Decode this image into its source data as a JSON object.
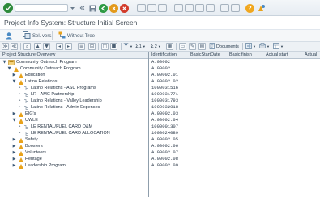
{
  "window": {
    "title": "Project Info System: Structure Initial Screen"
  },
  "app_toolbar": {
    "sel_vers_label": "Sel. vers.",
    "without_tree_label": "Without Tree"
  },
  "tree_toolbar": {
    "count_1": "1",
    "count_2": "2",
    "documents_label": "Documents"
  },
  "columns": {
    "overview": "Project Structure Overview",
    "identification": "Identification",
    "basic_start": "BasicStartDate",
    "basic_finish": "Basic finish",
    "actual_start": "Actual start",
    "actual_finish": "Actual"
  },
  "tree": [
    {
      "label": "Community Outreach Program",
      "id": "A.00002"
    },
    {
      "label": "Community Outreach Program",
      "id": "A.00002"
    },
    {
      "label": "Education",
      "id": "A.00002.01"
    },
    {
      "label": "Latino Relations",
      "id": "A.00002.02"
    },
    {
      "label": "Latino Relations - ASU Programs",
      "id": "1000031516"
    },
    {
      "label": "LR - AMC Partnership",
      "id": "1000031771"
    },
    {
      "label": "Latino Relations - Valley Leadership",
      "id": "1000031793"
    },
    {
      "label": "Latino Relations - Admin Expenses",
      "id": "1000032018"
    },
    {
      "label": "EIG's",
      "id": "A.00002.03"
    },
    {
      "label": "UWLE",
      "id": "A.00002.04"
    },
    {
      "label": "LE RENTAL/FUEL CARD O&M",
      "id": "1000001307"
    },
    {
      "label": "LE RENTAL/FUEL CARD ALLOCATION",
      "id": "1000024089"
    },
    {
      "label": "Safety",
      "id": "A.00002.05"
    },
    {
      "label": "Boosters",
      "id": "A.00002.06"
    },
    {
      "label": "Volunteers",
      "id": "A.00002.07"
    },
    {
      "label": "Heritage",
      "id": "A.00002.08"
    },
    {
      "label": "Leadership Program",
      "id": "A.00002.09"
    }
  ]
}
